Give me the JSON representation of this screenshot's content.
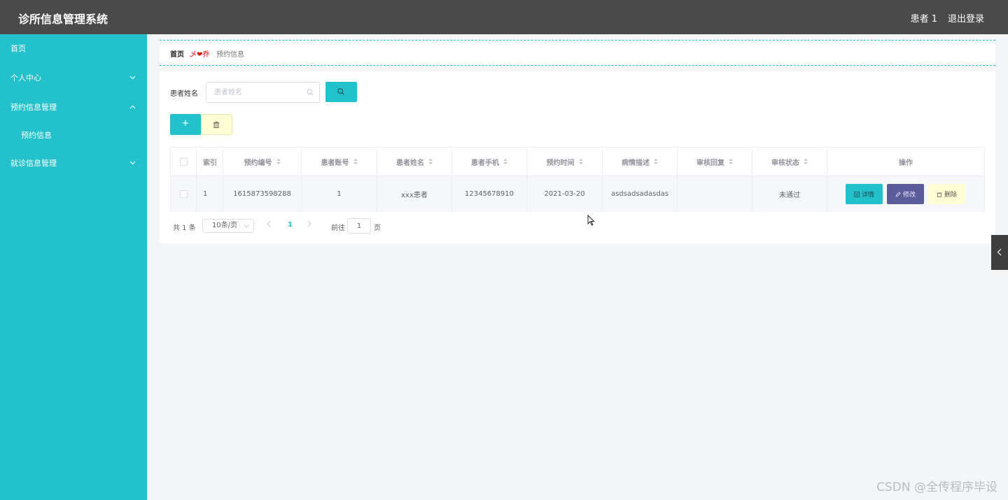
{
  "app": {
    "title": "诊所信息管理系统"
  },
  "header": {
    "user": "患者 1",
    "logout": "退出登录"
  },
  "sidebar": {
    "items": [
      {
        "label": "首页",
        "chevron": ""
      },
      {
        "label": "个人中心",
        "chevron": "chevron-down"
      },
      {
        "label": "预约信息管理",
        "chevron": "chevron-up"
      },
      {
        "label": "预约信息",
        "chevron": ""
      },
      {
        "label": "就诊信息管理",
        "chevron": "chevron-down"
      }
    ]
  },
  "breadcrumb": {
    "home": "首页",
    "separator": "乄❤乔",
    "current": "预约信息"
  },
  "search": {
    "label": "患者姓名",
    "placeholder": "患者姓名",
    "value": ""
  },
  "toolbar": {
    "add_symbol": "+"
  },
  "table": {
    "columns": [
      "",
      "索引",
      "预约编号",
      "患者账号",
      "患者姓名",
      "患者手机",
      "预约时间",
      "病情描述",
      "审核回复",
      "审核状态",
      "操作"
    ],
    "rows": [
      {
        "index": "1",
        "appointment_no": "1615873598288",
        "patient_account": "1",
        "patient_name": "xxx患者",
        "patient_phone": "12345678910",
        "appointment_time": "2021-03-20",
        "description": "asdsadsadasdas",
        "review_reply": "",
        "review_status": "未通过"
      }
    ],
    "actions": {
      "detail": "详情",
      "edit": "修改",
      "delete": "删除"
    }
  },
  "pagination": {
    "total": "共 1 条",
    "page_size": "10条/页",
    "current_page": "1",
    "goto_label": "前往",
    "goto_value": "1",
    "goto_unit": "页"
  },
  "watermark": "CSDN @全传程序毕设",
  "colors": {
    "accent": "#22c1cb",
    "topbar": "#4a4a4a",
    "edit": "#5c5c9a",
    "delete": "#fefdd3"
  }
}
